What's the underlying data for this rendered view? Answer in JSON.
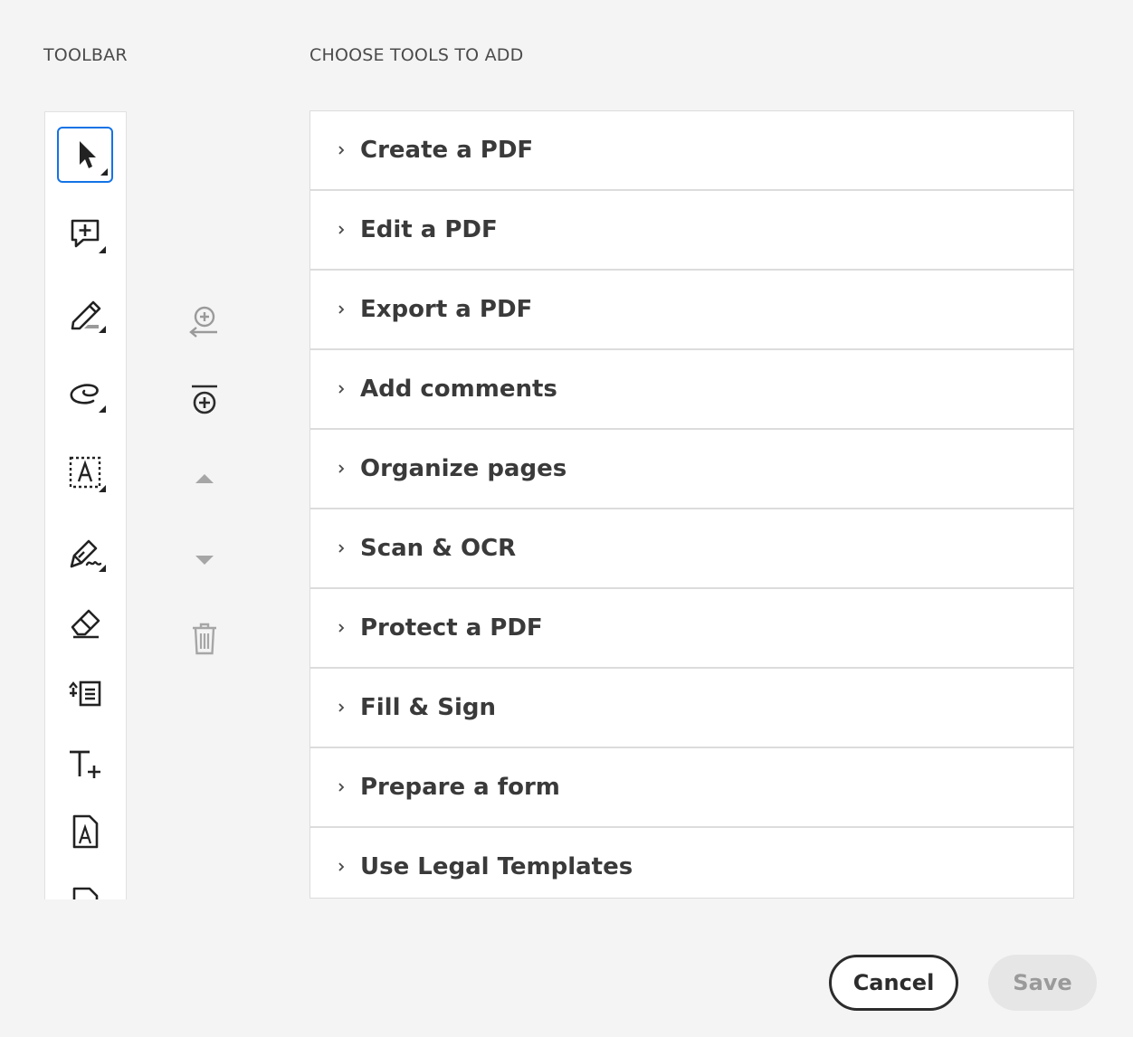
{
  "labels": {
    "toolbar": "TOOLBAR",
    "choose_tools": "CHOOSE TOOLS TO ADD"
  },
  "toolbar_tools": [
    {
      "icon": "select-arrow-icon",
      "selected": true
    },
    {
      "icon": "add-comment-icon",
      "selected": false
    },
    {
      "icon": "highlight-pen-icon",
      "selected": false
    },
    {
      "icon": "freehand-draw-icon",
      "selected": false
    },
    {
      "icon": "text-box-select-icon",
      "selected": false
    },
    {
      "icon": "sign-pen-icon",
      "selected": false
    },
    {
      "icon": "eraser-icon",
      "selected": false
    },
    {
      "icon": "insert-text-icon",
      "selected": false
    },
    {
      "icon": "add-text-icon",
      "selected": false
    },
    {
      "icon": "text-document-icon",
      "selected": false
    },
    {
      "icon": "document-icon",
      "selected": false
    }
  ],
  "actions": [
    {
      "icon": "add-to-toolbar-icon",
      "enabled": false
    },
    {
      "icon": "add-divider-icon",
      "enabled": true
    },
    {
      "icon": "move-up-icon",
      "enabled": false
    },
    {
      "icon": "move-down-icon",
      "enabled": false
    },
    {
      "icon": "trash-icon",
      "enabled": false
    }
  ],
  "categories": [
    {
      "label": "Create a PDF"
    },
    {
      "label": "Edit a PDF"
    },
    {
      "label": "Export a PDF"
    },
    {
      "label": "Add comments"
    },
    {
      "label": "Organize pages"
    },
    {
      "label": "Scan & OCR"
    },
    {
      "label": "Protect a PDF"
    },
    {
      "label": "Fill & Sign"
    },
    {
      "label": "Prepare a form"
    },
    {
      "label": "Use Legal Templates"
    }
  ],
  "buttons": {
    "cancel": "Cancel",
    "save": "Save"
  },
  "colors": {
    "selection_accent": "#1473e6",
    "background": "#f4f4f4"
  }
}
